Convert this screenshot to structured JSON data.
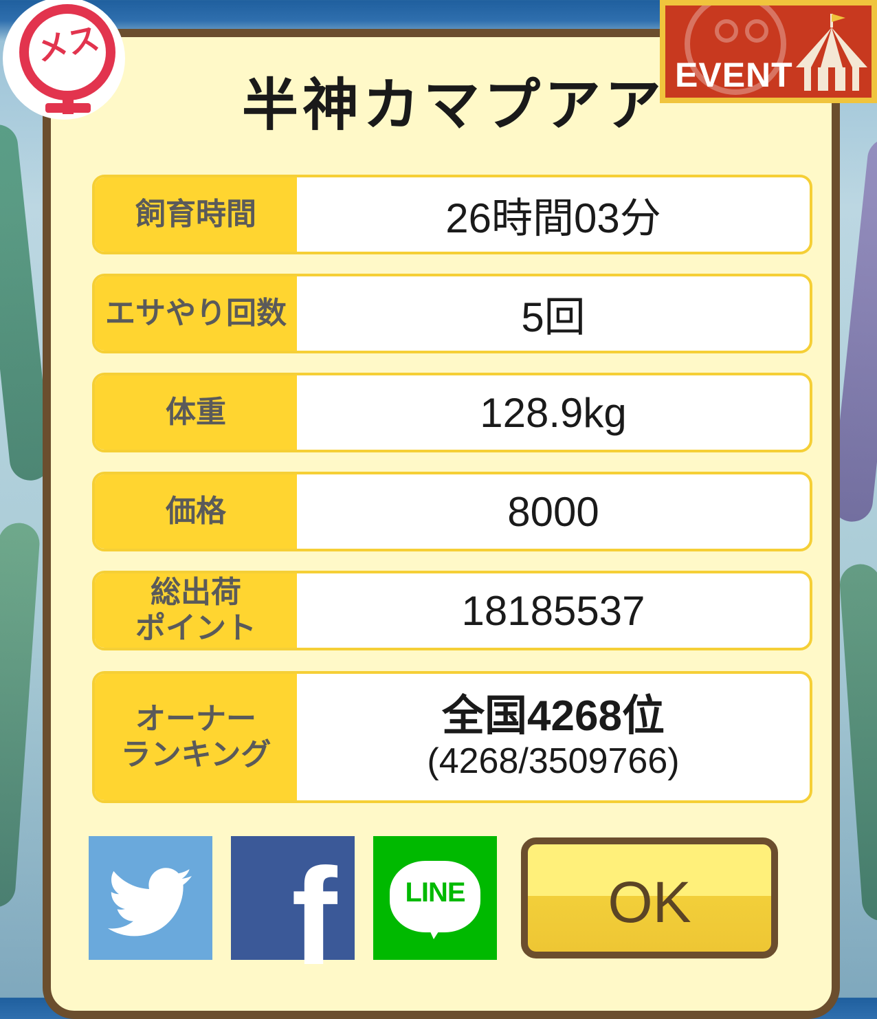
{
  "title": "半神カマプアア",
  "gender_badge": "メス",
  "event_badge": "EVENT",
  "stats": [
    {
      "label": "飼育時間",
      "value": "26時間03分"
    },
    {
      "label": "エサやり回数",
      "value": "5回"
    },
    {
      "label": "体重",
      "value": "128.9kg"
    },
    {
      "label": "価格",
      "value": "8000"
    },
    {
      "label_line1": "総出荷",
      "label_line2": "ポイント",
      "value": "18185537"
    },
    {
      "label_line1": "オーナー",
      "label_line2": "ランキング",
      "value_main": "全国4268位",
      "value_sub": "(4268/3509766)"
    }
  ],
  "share": {
    "twitter_icon": "twitter-bird-icon",
    "facebook_icon": "facebook-f-icon",
    "facebook_letter": "f",
    "line_icon": "line-icon",
    "line_label": "LINE"
  },
  "ok_label": "OK",
  "colors": {
    "frame": "#6b4e2e",
    "panel": "#fff9c8",
    "label_bg": "#ffd530",
    "twitter": "#6aa9dc",
    "facebook": "#3b5998",
    "line": "#00b900",
    "gender": "#e2344e",
    "event": "#c8391f"
  }
}
